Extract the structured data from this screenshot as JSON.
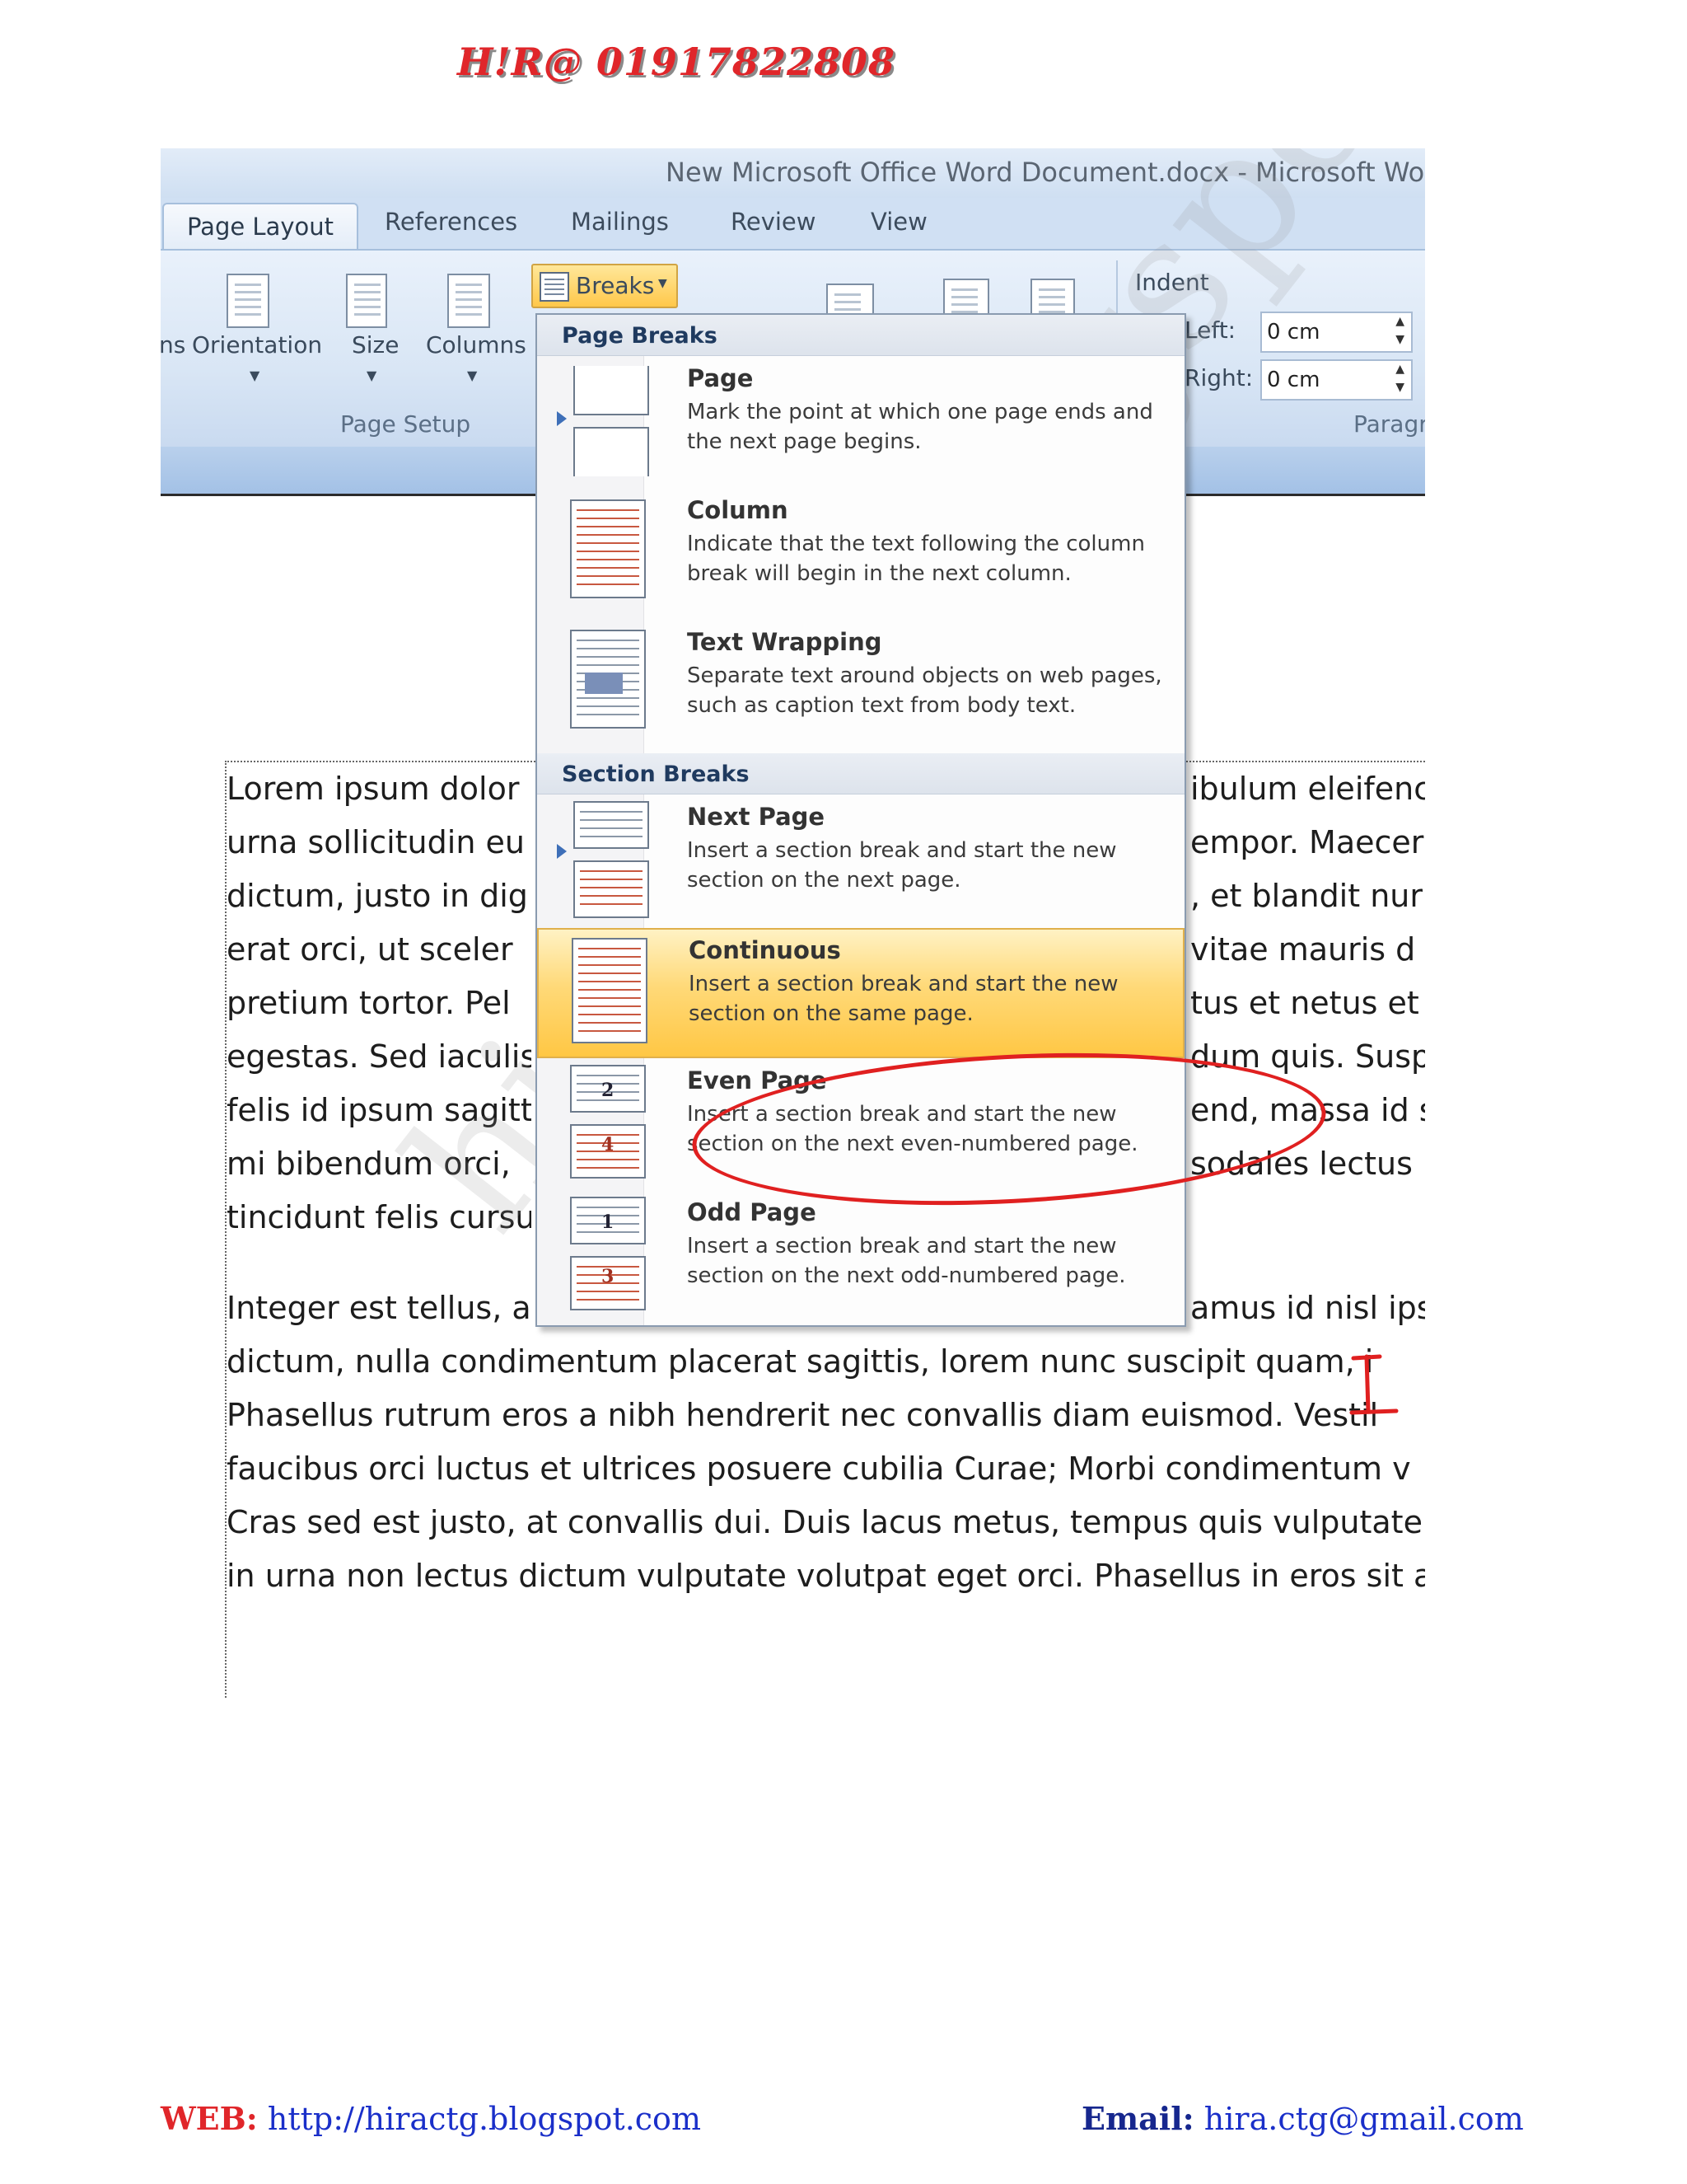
{
  "header_contact": "H!R@ 01917822808",
  "window": {
    "title": "New Microsoft Office Word Document.docx - Microsoft Wo"
  },
  "ribbon": {
    "tabs": [
      "Page Layout",
      "References",
      "Mailings",
      "Review",
      "View"
    ],
    "page_setup": {
      "buttons": [
        "ns",
        "Orientation",
        "Size",
        "Columns"
      ],
      "breaks_label": "Breaks",
      "group_label": "Page Setup"
    },
    "indent": {
      "label": "Indent",
      "left_label": "Left:",
      "left_value": "0 cm",
      "right_label": "Right:",
      "right_value": "0 cm"
    },
    "paragraph_group_label": "Paragr"
  },
  "breaks_menu": {
    "page_breaks_header": "Page Breaks",
    "section_breaks_header": "Section Breaks",
    "page_breaks": [
      {
        "title": "Page",
        "desc": "Mark the point at which one page ends and the next page begins."
      },
      {
        "title": "Column",
        "desc": "Indicate that the text following the column break will begin in the next column."
      },
      {
        "title": "Text Wrapping",
        "desc": "Separate text around objects on web pages, such as caption text from body text."
      }
    ],
    "section_breaks": [
      {
        "title": "Next Page",
        "desc": "Insert a section break and start the new section on the next page."
      },
      {
        "title": "Continuous",
        "desc": "Insert a section break and start the new section on the same page."
      },
      {
        "title": "Even Page",
        "desc": "Insert a section break and start the new section on the next even-numbered page."
      },
      {
        "title": "Odd Page",
        "desc": "Insert a section break and start the new section on the next odd-numbered page."
      }
    ],
    "icon_numbers": {
      "even_top": "2",
      "even_bottom": "4",
      "odd_top": "1",
      "odd_bottom": "3"
    },
    "highlighted_item": "Continuous"
  },
  "document": {
    "left_lines": [
      "Lorem ipsum dolor",
      "urna sollicitudin eu",
      "dictum, justo in dig",
      "erat orci, ut sceler",
      "pretium tortor. Pel",
      "egestas. Sed iaculis",
      "felis id ipsum sagitt",
      "mi bibendum orci,",
      "tincidunt felis cursu",
      "Integer est tellus, a"
    ],
    "right_lines": [
      "ibulum eleifenc",
      "empor. Maecer",
      ", et blandit nur",
      "vitae mauris d",
      "tus et netus et",
      "dum quis. Susp",
      "end, massa id s",
      "sodales lectus",
      "",
      "amus id nisl ipsu"
    ],
    "full_lines": [
      "dictum, nulla condimentum placerat sagittis, lorem nunc suscipit quam, i",
      "Phasellus rutrum eros a nibh hendrerit nec convallis diam euismod. Vestil",
      "faucibus orci luctus et ultrices posuere cubilia Curae; Morbi condimentum v",
      "Cras sed est justo, at convallis dui. Duis lacus metus, tempus quis vulputate",
      "in urna non lectus dictum vulputate volutpat eget orci. Phasellus in eros sit ar"
    ]
  },
  "watermark": "hiractg.blogspot.com",
  "footer": {
    "web_label": "WEB:",
    "web_url": "http://hiractg.blogspot.com",
    "email_label": "Email:",
    "email_value": "hira.ctg@gmail.com"
  },
  "colors": {
    "accent_red": "#e0262a",
    "menu_highlight": "#ffd978",
    "link_blue": "#1a2fc9",
    "ribbon_blue": "#d0e0f3"
  }
}
